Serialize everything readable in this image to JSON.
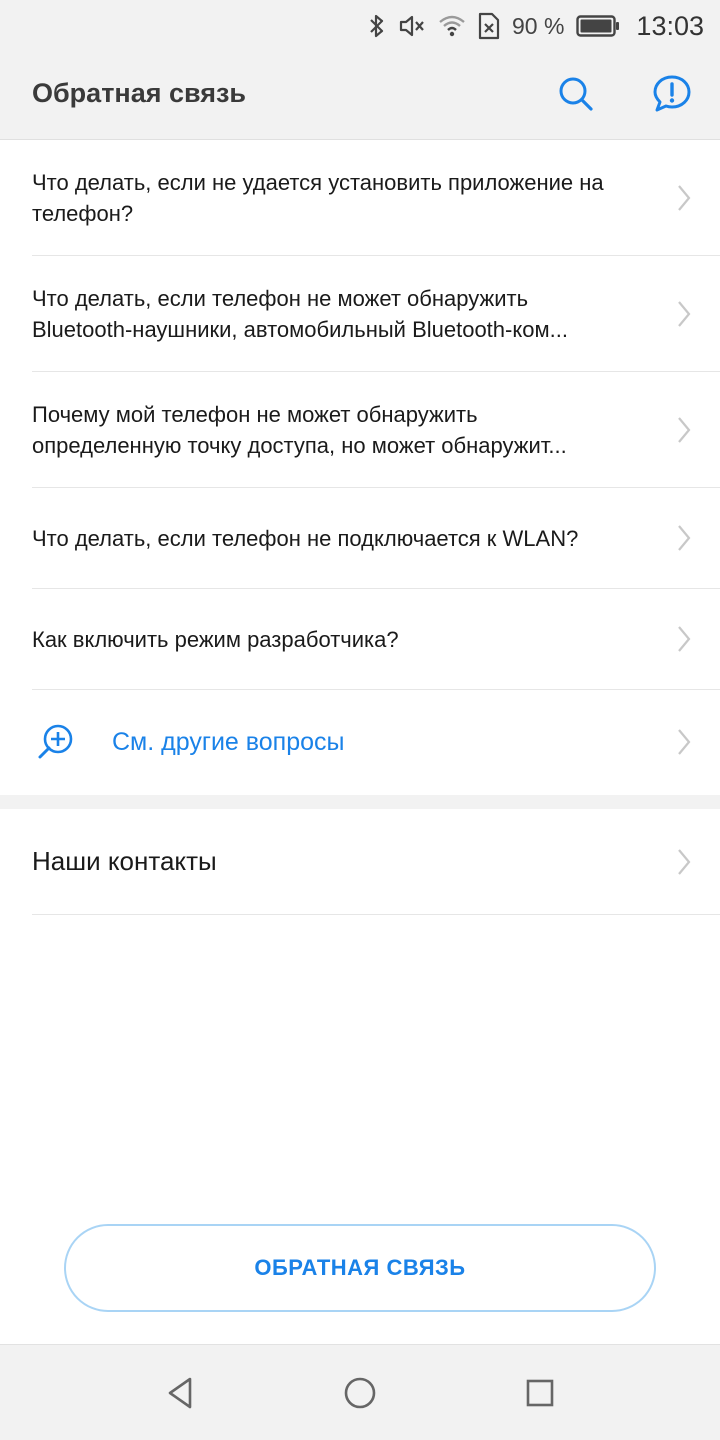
{
  "status_bar": {
    "battery_percent": "90 %",
    "time": "13:03",
    "icons": [
      "bluetooth-icon",
      "mute-icon",
      "wifi-icon",
      "no-sim-icon",
      "battery-icon"
    ]
  },
  "title_bar": {
    "title": "Обратная связь",
    "actions": [
      "search-icon",
      "feedback-icon"
    ]
  },
  "faq": {
    "items": [
      {
        "text": "Что делать, если не удается установить приложение на телефон?"
      },
      {
        "text": "Что делать, если телефон не может обнаружить Bluetooth-наушники, автомобильный Bluetooth-ком..."
      },
      {
        "text": "Почему мой телефон не может обнаружить определенную точку доступа, но может обнаружит..."
      },
      {
        "text": "Что делать, если телефон не подключается к WLAN?"
      },
      {
        "text": "Как включить режим разработчика?"
      }
    ],
    "more_label": "См. другие вопросы"
  },
  "contacts": {
    "label": "Наши контакты"
  },
  "feedback_button": {
    "label": "ОБРАТНАЯ СВЯЗЬ"
  },
  "colors": {
    "accent": "#1a82e8",
    "bar_background": "#f2f2f2",
    "chevron": "#c8c8c8"
  }
}
